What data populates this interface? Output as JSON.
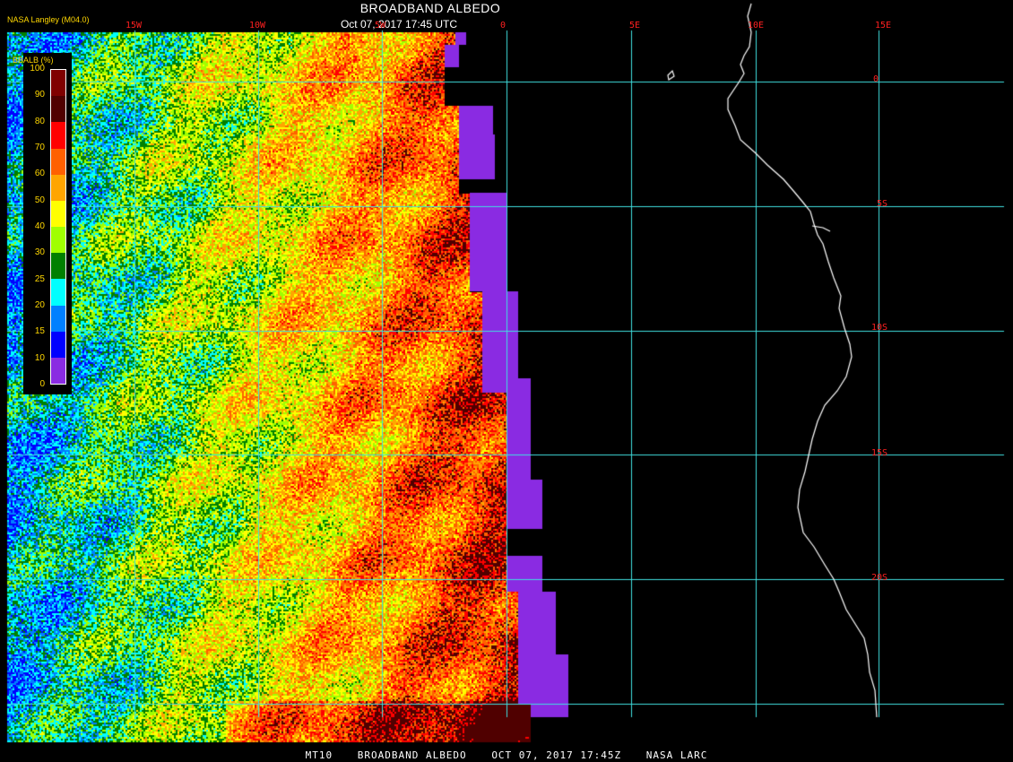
{
  "header": {
    "title": "BROADBAND ALBEDO",
    "datetime": "Oct 07, 2017 17:45 UTC",
    "producer": "NASA Langley (M04.0)"
  },
  "footer": {
    "product": "MT10",
    "name": "BROADBAND ALBEDO",
    "datetime": "OCT 07, 2017 17:45Z",
    "source": "NASA LARC"
  },
  "legend": {
    "title": "BBALB (%)",
    "levels": [
      "100",
      "90",
      "80",
      "70",
      "60",
      "50",
      "40",
      "30",
      "25",
      "20",
      "15",
      "10",
      "0"
    ],
    "colors": [
      "#800000",
      "#500000",
      "#ff0000",
      "#ff6000",
      "#ffa500",
      "#ffff00",
      "#a0ff00",
      "#008000",
      "#00ffff",
      "#0080ff",
      "#0000ff",
      "#8a2be2"
    ]
  },
  "grid": {
    "color": "#40e0e0",
    "lon_labels": [
      "15W",
      "10W",
      "5W",
      "0",
      "5E",
      "10E",
      "15E"
    ],
    "lat_labels": [
      "0",
      "5S",
      "10S",
      "15S",
      "20S"
    ]
  },
  "colors": {
    "background": "#000000",
    "coastline": "#ffffff",
    "label_yellow": "#ffd700",
    "tick_red": "#ff2020",
    "no_data_purple": "#8a2be2"
  }
}
